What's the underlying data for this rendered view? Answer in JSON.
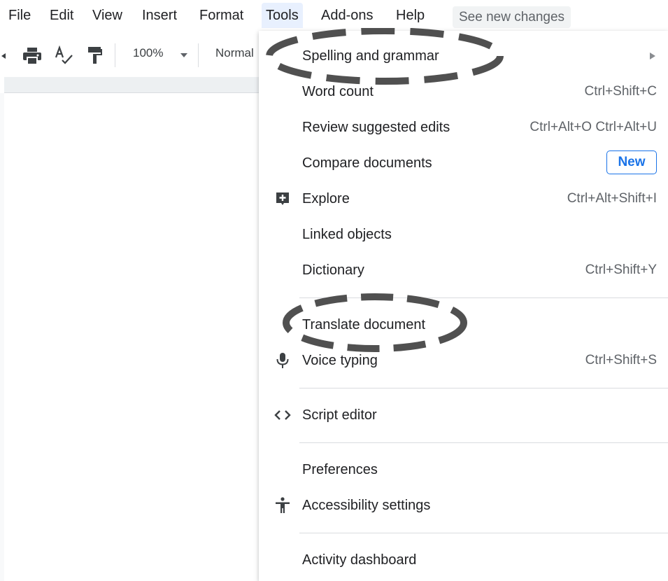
{
  "menubar": {
    "items": [
      "File",
      "Edit",
      "View",
      "Insert",
      "Format",
      "Tools",
      "Add-ons",
      "Help"
    ],
    "active": "Tools",
    "see_new_changes": "See new changes"
  },
  "toolbar": {
    "zoom": "100%",
    "style": "Normal",
    "icons": [
      "print-icon",
      "spellcheck-icon",
      "paint-format-icon"
    ]
  },
  "tools_menu": {
    "items": [
      {
        "label": "Spelling and grammar",
        "shortcut": "",
        "submenu": true
      },
      {
        "label": "Word count",
        "shortcut": "Ctrl+Shift+C"
      },
      {
        "label": "Review suggested edits",
        "shortcut": "Ctrl+Alt+O Ctrl+Alt+U"
      },
      {
        "label": "Compare documents",
        "badge": "New"
      },
      {
        "label": "Explore",
        "shortcut": "Ctrl+Alt+Shift+I",
        "icon": "explore-icon"
      },
      {
        "label": "Linked objects",
        "shortcut": ""
      },
      {
        "label": "Dictionary",
        "shortcut": "Ctrl+Shift+Y"
      },
      {
        "label": "Translate document",
        "shortcut": ""
      },
      {
        "label": "Voice typing",
        "shortcut": "Ctrl+Shift+S",
        "icon": "microphone-icon"
      },
      {
        "label": "Script editor",
        "shortcut": "",
        "icon": "code-icon"
      },
      {
        "label": "Preferences",
        "shortcut": ""
      },
      {
        "label": "Accessibility settings",
        "shortcut": "",
        "icon": "accessibility-icon"
      },
      {
        "label": "Activity dashboard",
        "shortcut": ""
      }
    ]
  },
  "annotations": {
    "highlighted": [
      "Spelling and grammar",
      "Translate document"
    ],
    "style": "dashed-ellipse",
    "color": "#505050"
  },
  "colors": {
    "accent": "#1a73e8",
    "active_menu_bg": "#e8f0fe",
    "text": "#202124",
    "shortcut_text": "#5f6368"
  }
}
